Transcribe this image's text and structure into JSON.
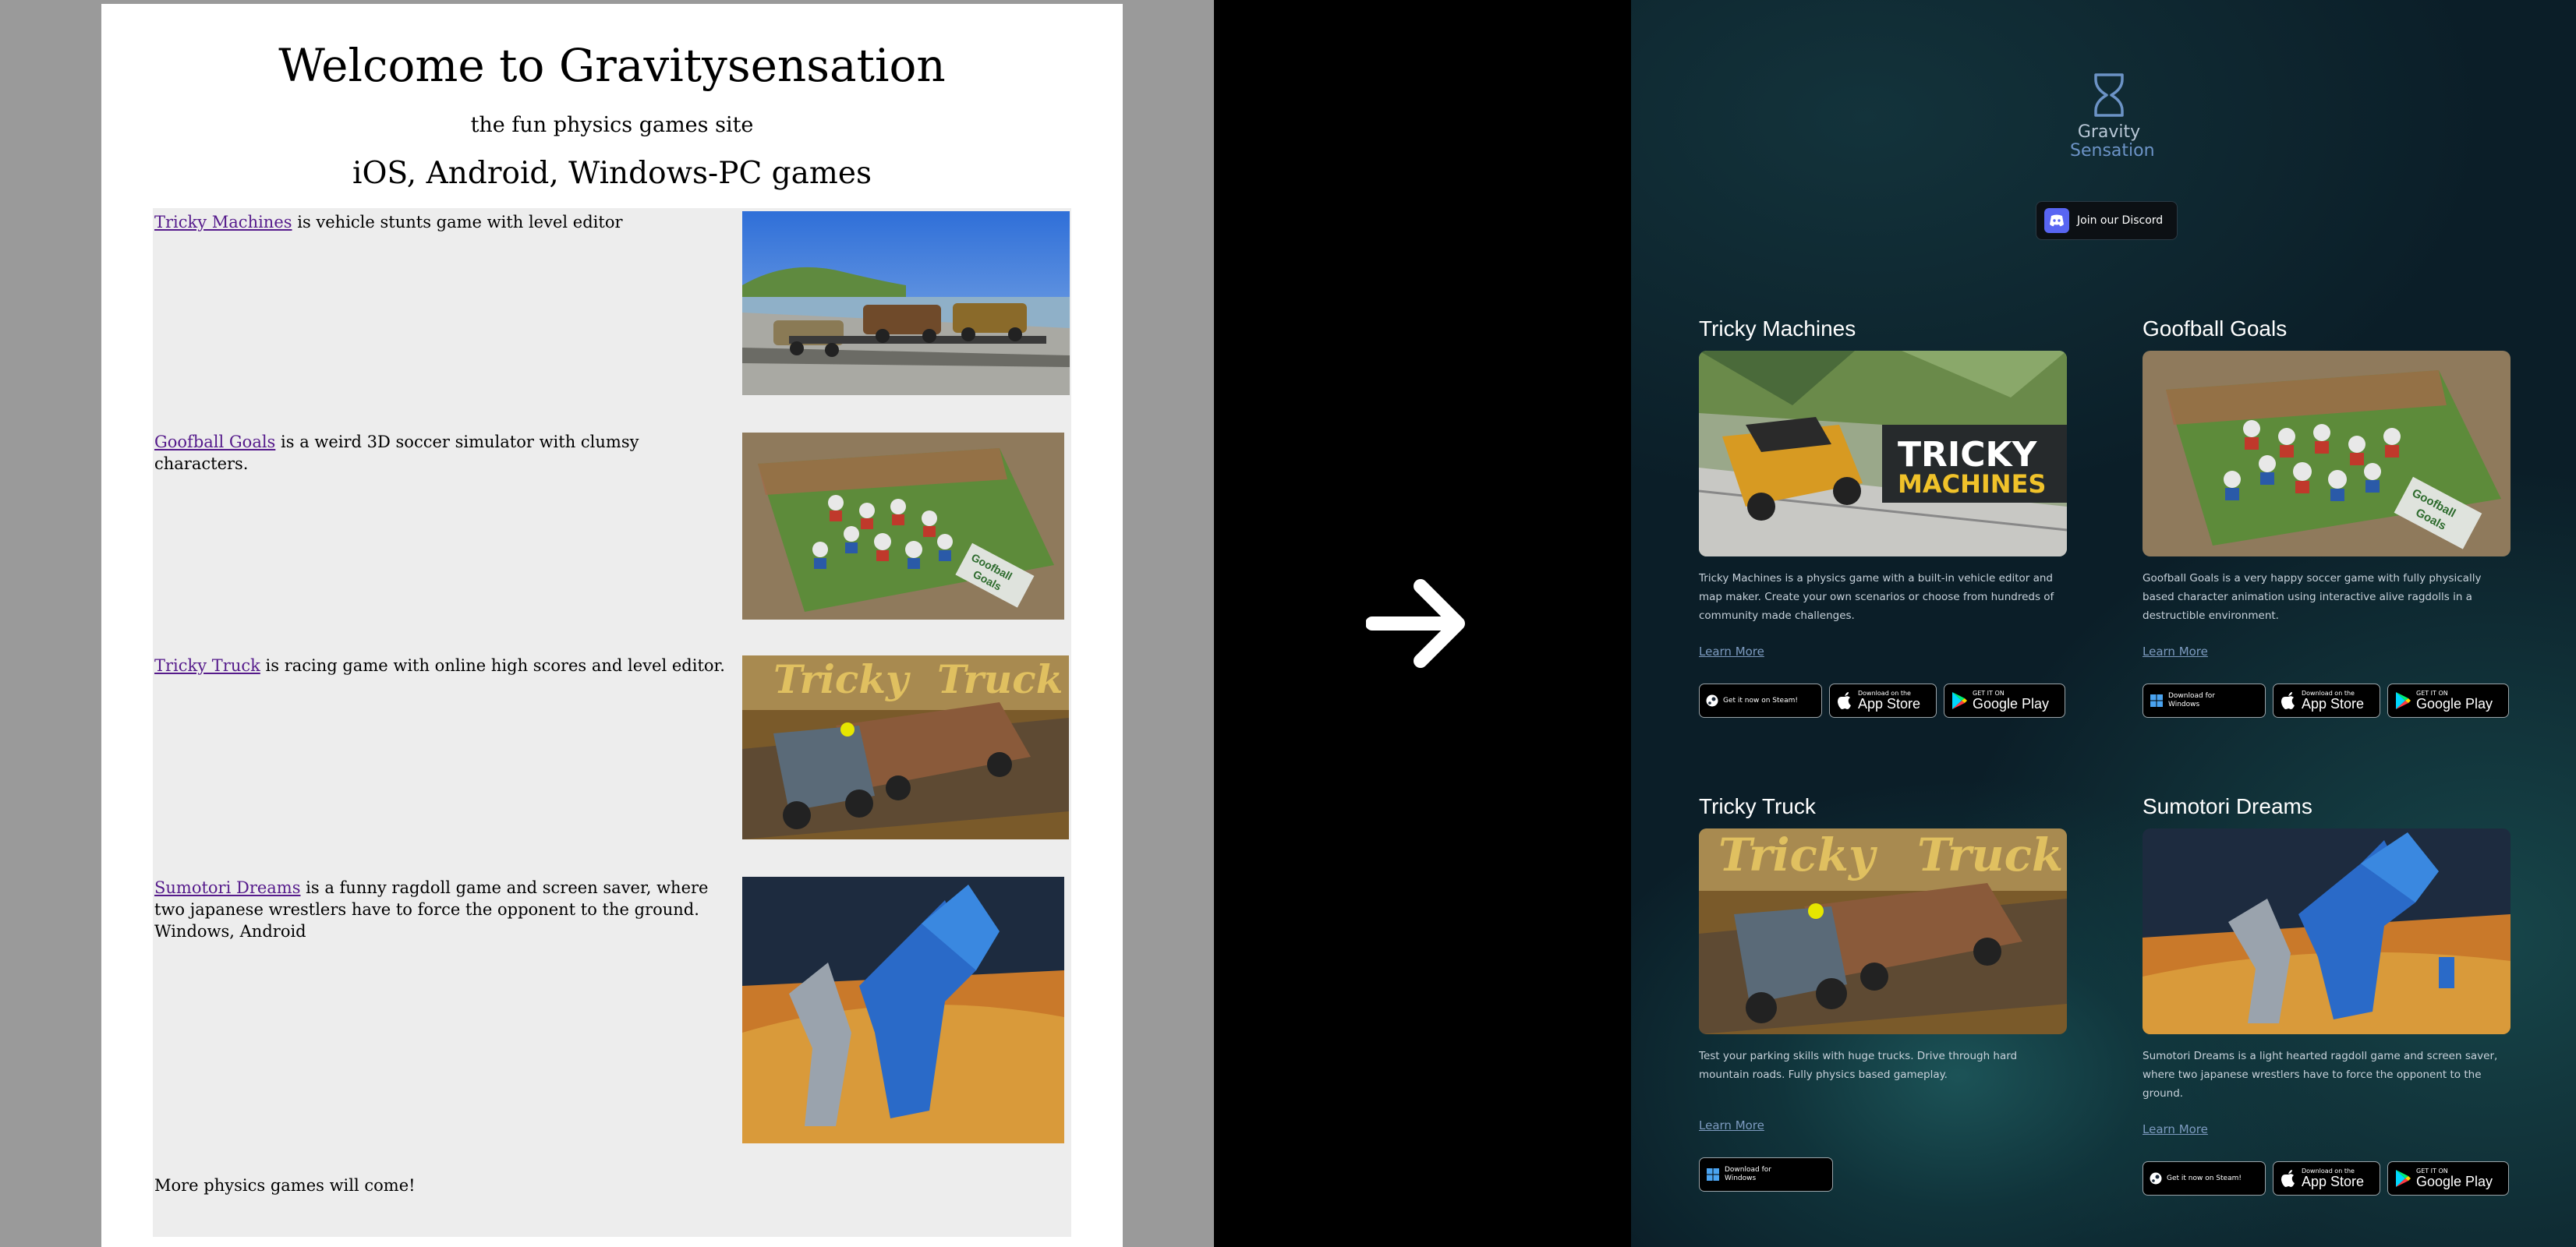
{
  "old_site": {
    "title": "Welcome to Gravitysensation",
    "subtitle": "the fun physics games site",
    "platforms": "iOS, Android, Windows-PC games",
    "games": [
      {
        "link": "Tricky Machines",
        "text": " is vehicle stunts game with level editor",
        "extra": ""
      },
      {
        "link": "Goofball Goals",
        "text": " is a weird 3D soccer simulator with clumsy characters.",
        "extra": ""
      },
      {
        "link": "Tricky Truck",
        "text": " is racing game with online high scores and level editor.",
        "extra": ""
      },
      {
        "link": "Sumotori Dreams",
        "text": " is a funny ragdoll game and screen saver, where two japanese wrestlers have to force the opponent to the ground.",
        "extra": "Windows, Android"
      }
    ],
    "more": "More physics games will come!"
  },
  "new_site": {
    "logo_line1": "Gravity",
    "logo_line2": "Sensation",
    "discord": "Join our Discord",
    "learn_more": "Learn More",
    "cards": [
      {
        "title": "Tricky Machines",
        "desc": "Tricky Machines is a physics game with a built-in vehicle editor and map maker. Create your own scenarios or choose from hundreds of community made challenges.",
        "img_text_1": "TRICKY",
        "img_text_2": "MACHINES"
      },
      {
        "title": "Goofball Goals",
        "desc": "Goofball Goals is a very happy soccer game with fully physically based character animation using interactive alive ragdolls in a destructible environment.",
        "img_text_1": "Goofball",
        "img_text_2": "Goals"
      },
      {
        "title": "Tricky Truck",
        "desc": "Test your parking skills with huge trucks. Drive through hard mountain roads. Fully physics based gameplay.",
        "img_text_1": "Tricky",
        "img_text_2": "Truck"
      },
      {
        "title": "Sumotori Dreams",
        "desc": "Sumotori Dreams is a light hearted ragdoll game and screen saver, where two japanese wrestlers have to force the opponent to the ground.",
        "img_text_1": "",
        "img_text_2": ""
      }
    ],
    "badges": {
      "steam": "Get it now on Steam!",
      "app_small": "Download on the",
      "app_big": "App Store",
      "play_small": "GET IT ON",
      "play_big": "Google Play",
      "win_small_1": "Download for",
      "win_small_2": "Windows"
    }
  },
  "old_img_labels": {
    "truck_1": "Tricky",
    "truck_2": "Truck",
    "goof_1": "Goofball",
    "goof_2": "Goals"
  }
}
